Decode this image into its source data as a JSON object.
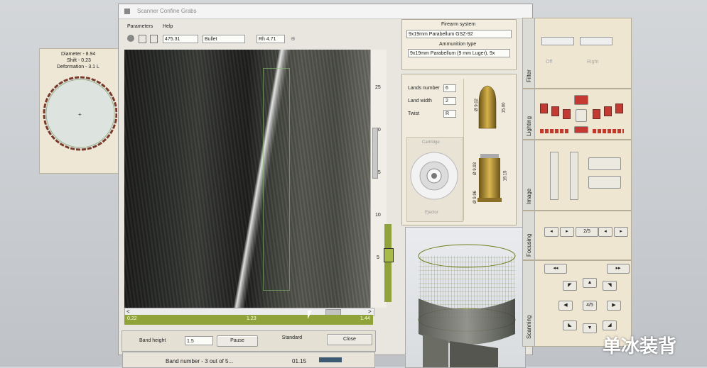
{
  "title_bar": {
    "title": "Scanner Confine Grabs"
  },
  "menu": {
    "items": [
      "Parameters",
      "Help"
    ]
  },
  "toolbar": {
    "coord_value": "475.31",
    "mode_value": "Bullet",
    "rh_value": "Rh 4.71"
  },
  "measure": {
    "diameter": "Diameter - 8.94",
    "shift": "Shift - 0.23",
    "deformation": "Deformation - 3.1 L"
  },
  "ruler": {
    "ticks": [
      "25",
      "20",
      "15",
      "10",
      "5"
    ]
  },
  "scrollbar": {
    "left_arrow": "<",
    "right_arrow": ">"
  },
  "position_bar": {
    "left": "0.22",
    "center": "1.23",
    "right": "1.44"
  },
  "bottom_controls": {
    "band_height_label": "Band height",
    "band_height_value": "1.5",
    "pause_label": "Pause",
    "standard_label": "Standard",
    "close_label": "Close"
  },
  "status_bar": {
    "band_number": "Band number - 3 out of 5...",
    "time": "01.15"
  },
  "firearm": {
    "system_label": "Firearm system",
    "system_value": "9x19mm Parabellum GSZ-92",
    "ammo_label": "Ammunition type",
    "ammo_value": "9x19mm Parabellum (9 mm Luger), 9x"
  },
  "specs": {
    "lands_label": "Lands number",
    "lands_value": "6",
    "width_label": "Land width",
    "width_value": "2",
    "twist_label": "Twist",
    "twist_value": "R"
  },
  "bullet_dims": {
    "top_left": "Ø 9.02",
    "top_len": "15.00",
    "bottom_left": "Ø 9.93",
    "bottom_len": "19.15",
    "base": "Ø 9.96"
  },
  "cartridge": {
    "top_label": "Cartridge",
    "bottom_label": "Ejector"
  },
  "side_tabs": {
    "filter": "Filter",
    "lighting": "Lighting",
    "image": "Image",
    "focusing": "Focusing",
    "scanning": "Scanning"
  },
  "filter_panel": {
    "chk1": "Off",
    "chk2": "Right"
  },
  "focus_buttons": {
    "b1": "◂",
    "b2": "▸",
    "b3": "2/5",
    "b4": "◂",
    "b5": "▸"
  },
  "scan_buttons": {
    "left": "◂◂",
    "right": "▸▸",
    "center": "4/5"
  },
  "watermark": {
    "text": "单冰装背"
  },
  "colors": {
    "olive": "#8fa33a",
    "red": "#c43a32"
  }
}
